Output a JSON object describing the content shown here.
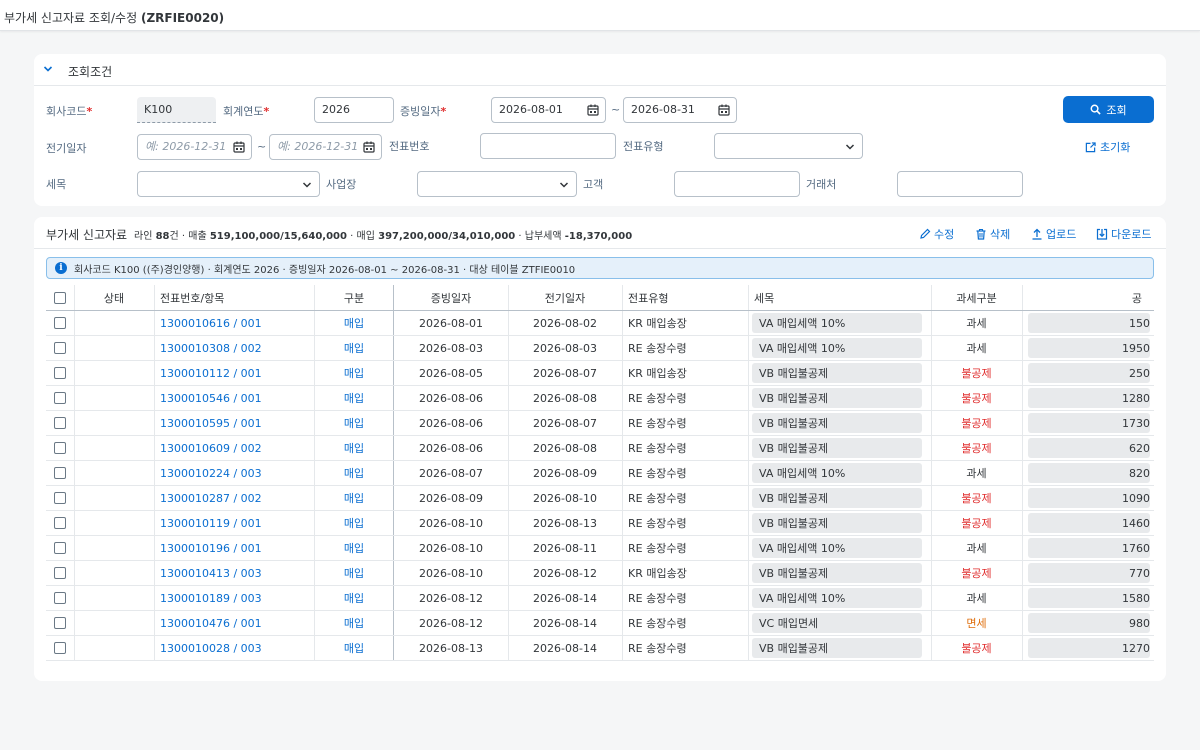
{
  "shell": {
    "title": "부가세 신고자료 조회/수정",
    "tcode": "(ZRFIE0020)"
  },
  "filter": {
    "title": "조회조건",
    "company_label": "회사코드",
    "company_value": "K100",
    "year_label": "회계연도",
    "year_value": "2026",
    "doc_date_label": "증빙일자",
    "doc_date_from": "2026-08-01",
    "doc_date_to": "2026-08-31",
    "posting_date_label": "전기일자",
    "posting_from_placeholder": "예: 2026-12-31",
    "posting_to_placeholder": "예: 2026-12-31",
    "doc_no_label": "전표번호",
    "doc_no_value": "",
    "doc_type_label": "전표유형",
    "doc_type_value": "",
    "tax_item_label": "세목",
    "tax_item_value": "",
    "business_place_label": "사업장",
    "business_place_value": "",
    "customer_label": "고객",
    "customer_value": "",
    "vendor_label": "거래처",
    "vendor_value": "",
    "tilde": "~",
    "search_button": "조회",
    "reset_button": "초기화"
  },
  "table_panel": {
    "title": "부가세 신고자료",
    "summary": {
      "lines_prefix": "라인 ",
      "lines_count": "88",
      "lines_suffix": "건 · 매출 ",
      "sales": "519,100,000/15,640,000",
      "purchase_prefix": " · 매입 ",
      "purchase": "397,200,000/34,010,000",
      "payable_prefix": " · 납부세액 ",
      "payable": "-18,370,000"
    },
    "toolbar": {
      "edit": "수정",
      "delete": "삭제",
      "upload": "업로드",
      "download": "다운로드"
    },
    "info": "회사코드 K100 ((주)경인양행) · 회계연도 2026 · 증빙일자 2026-08-01 ~ 2026-08-31 · 대상 테이블 ZTFIE0010",
    "columns": {
      "status": "상태",
      "doc_item": "전표번호/항목",
      "division": "구분",
      "doc_date": "증빙일자",
      "posting_date": "전기일자",
      "doc_type": "전표유형",
      "tax_item": "세목",
      "tax_class": "과세구분",
      "amount_partial": "공"
    },
    "rows": [
      {
        "doc": "1300010616 / 001",
        "div": "매입",
        "doc_date": "2026-08-01",
        "post_date": "2026-08-02",
        "type": "KR 매입송장",
        "tax_item": "VA 매입세액 10%",
        "tax_class": "과세",
        "cls": "normal",
        "amount": "150"
      },
      {
        "doc": "1300010308 / 002",
        "div": "매입",
        "doc_date": "2026-08-03",
        "post_date": "2026-08-03",
        "type": "RE 송장수령",
        "tax_item": "VA 매입세액 10%",
        "tax_class": "과세",
        "cls": "normal",
        "amount": "1950"
      },
      {
        "doc": "1300010112 / 001",
        "div": "매입",
        "doc_date": "2026-08-05",
        "post_date": "2026-08-07",
        "type": "KR 매입송장",
        "tax_item": "VB 매입불공제",
        "tax_class": "불공제",
        "cls": "bad",
        "amount": "250"
      },
      {
        "doc": "1300010546 / 001",
        "div": "매입",
        "doc_date": "2026-08-06",
        "post_date": "2026-08-08",
        "type": "RE 송장수령",
        "tax_item": "VB 매입불공제",
        "tax_class": "불공제",
        "cls": "bad",
        "amount": "1280"
      },
      {
        "doc": "1300010595 / 001",
        "div": "매입",
        "doc_date": "2026-08-06",
        "post_date": "2026-08-07",
        "type": "RE 송장수령",
        "tax_item": "VB 매입불공제",
        "tax_class": "불공제",
        "cls": "bad",
        "amount": "1730"
      },
      {
        "doc": "1300010609 / 002",
        "div": "매입",
        "doc_date": "2026-08-06",
        "post_date": "2026-08-08",
        "type": "RE 송장수령",
        "tax_item": "VB 매입불공제",
        "tax_class": "불공제",
        "cls": "bad",
        "amount": "620"
      },
      {
        "doc": "1300010224 / 003",
        "div": "매입",
        "doc_date": "2026-08-07",
        "post_date": "2026-08-09",
        "type": "RE 송장수령",
        "tax_item": "VA 매입세액 10%",
        "tax_class": "과세",
        "cls": "normal",
        "amount": "820"
      },
      {
        "doc": "1300010287 / 002",
        "div": "매입",
        "doc_date": "2026-08-09",
        "post_date": "2026-08-10",
        "type": "RE 송장수령",
        "tax_item": "VB 매입불공제",
        "tax_class": "불공제",
        "cls": "bad",
        "amount": "1090"
      },
      {
        "doc": "1300010119 / 001",
        "div": "매입",
        "doc_date": "2026-08-10",
        "post_date": "2026-08-13",
        "type": "RE 송장수령",
        "tax_item": "VB 매입불공제",
        "tax_class": "불공제",
        "cls": "bad",
        "amount": "1460"
      },
      {
        "doc": "1300010196 / 001",
        "div": "매입",
        "doc_date": "2026-08-10",
        "post_date": "2026-08-11",
        "type": "RE 송장수령",
        "tax_item": "VA 매입세액 10%",
        "tax_class": "과세",
        "cls": "normal",
        "amount": "1760"
      },
      {
        "doc": "1300010413 / 003",
        "div": "매입",
        "doc_date": "2026-08-10",
        "post_date": "2026-08-12",
        "type": "KR 매입송장",
        "tax_item": "VB 매입불공제",
        "tax_class": "불공제",
        "cls": "bad",
        "amount": "770"
      },
      {
        "doc": "1300010189 / 003",
        "div": "매입",
        "doc_date": "2026-08-12",
        "post_date": "2026-08-14",
        "type": "RE 송장수령",
        "tax_item": "VA 매입세액 10%",
        "tax_class": "과세",
        "cls": "normal",
        "amount": "1580"
      },
      {
        "doc": "1300010476 / 001",
        "div": "매입",
        "doc_date": "2026-08-12",
        "post_date": "2026-08-14",
        "type": "RE 송장수령",
        "tax_item": "VC 매입면세",
        "tax_class": "면세",
        "cls": "exempt",
        "amount": "980"
      },
      {
        "doc": "1300010028 / 003",
        "div": "매입",
        "doc_date": "2026-08-13",
        "post_date": "2026-08-14",
        "type": "RE 송장수령",
        "tax_item": "VB 매입불공제",
        "tax_class": "불공제",
        "cls": "bad",
        "amount": "1270"
      }
    ]
  }
}
